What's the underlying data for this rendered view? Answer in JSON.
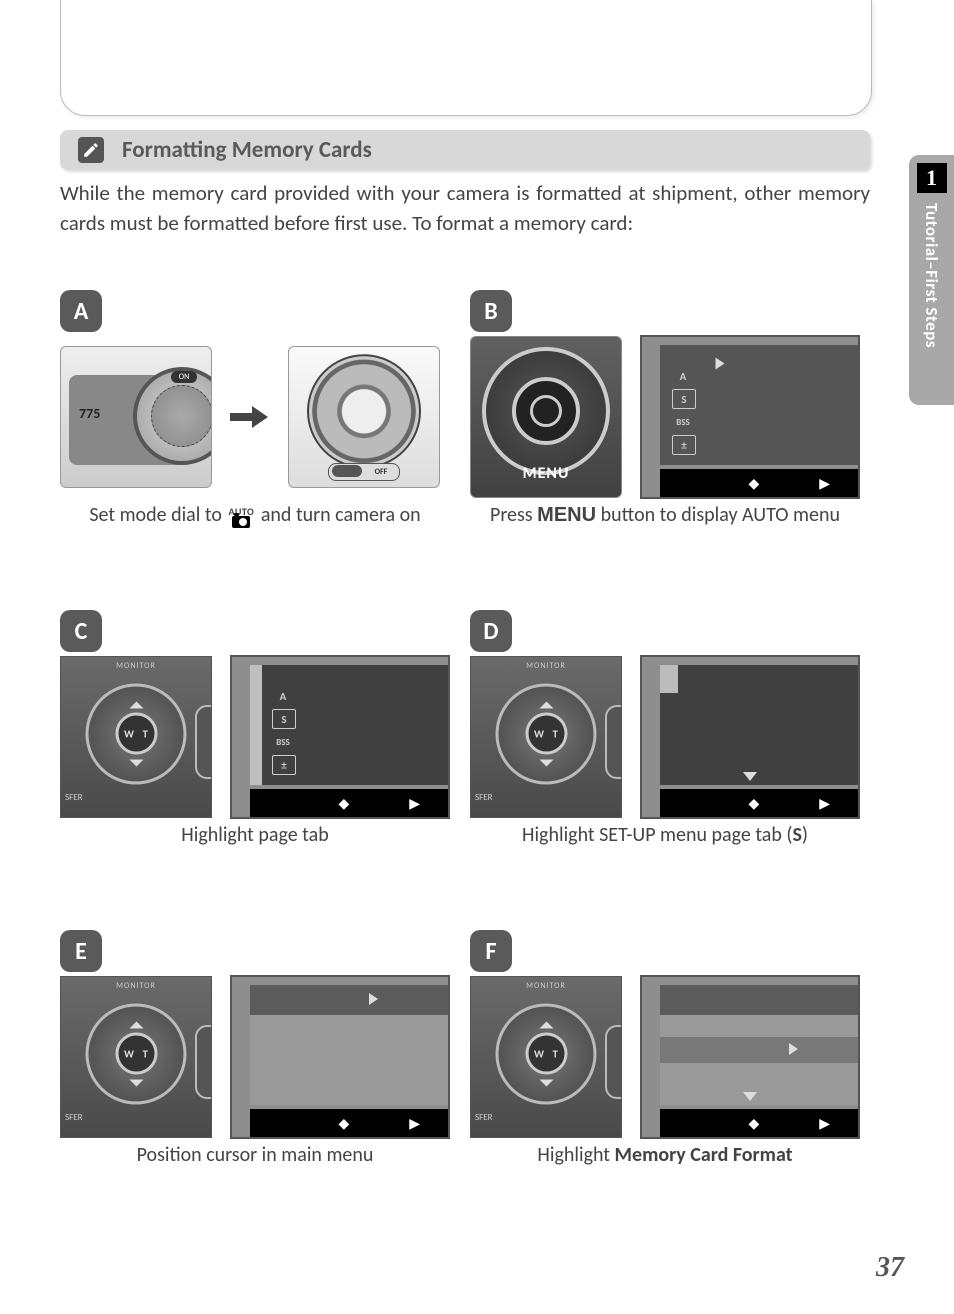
{
  "section": {
    "title": "Formatting Memory Cards",
    "intro": "While the memory card provided with your camera is formatted at shipment, other memory cards must be formatted before first use. To format a memory card:"
  },
  "sidebar": {
    "chapter_number": "1",
    "chapter_title": "Tutorial–First Steps"
  },
  "steps": {
    "A": {
      "label": "A",
      "caption_before": "Set mode dial to ",
      "caption_after": " and turn camera on",
      "model": "775",
      "on_label": "ON",
      "switch_on": "ON",
      "switch_off": "OFF",
      "auto_text": "AUTO"
    },
    "B": {
      "label": "B",
      "caption_before": "Press ",
      "caption_bold": "MENU",
      "caption_after": " button to display AUTO menu",
      "menu_label": "MENU"
    },
    "C": {
      "label": "C",
      "caption": "Highlight page tab",
      "monitor": "MONITOR",
      "w": "W",
      "t": "T",
      "sfer": "SFER"
    },
    "D": {
      "label": "D",
      "caption_before": "Highlight SET-UP menu page tab (",
      "caption_bold": "S",
      "caption_after": ")"
    },
    "E": {
      "label": "E",
      "caption": "Position cursor in main menu"
    },
    "F": {
      "label": "F",
      "caption_before": "Highlight ",
      "caption_bold": "Memory Card Format"
    }
  },
  "screen_icons": {
    "A": "A",
    "S": "S",
    "BSS": "BSS",
    "EV": "±"
  },
  "page_number": "37"
}
